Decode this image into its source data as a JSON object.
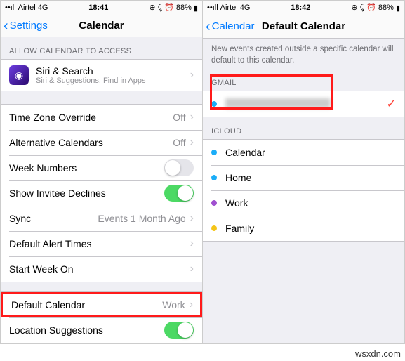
{
  "status": {
    "carrier": "Airtel",
    "network": "4G",
    "time_left": "18:41",
    "time_right": "18:42",
    "battery": "88%"
  },
  "left": {
    "back": "Settings",
    "title": "Calendar",
    "section1": "ALLOW CALENDAR TO ACCESS",
    "siri_title": "Siri & Search",
    "siri_sub": "Siri & Suggestions, Find in Apps",
    "rows": {
      "tzo": {
        "label": "Time Zone Override",
        "value": "Off"
      },
      "alt": {
        "label": "Alternative Calendars",
        "value": "Off"
      },
      "week": {
        "label": "Week Numbers"
      },
      "invitee": {
        "label": "Show Invitee Declines"
      },
      "sync": {
        "label": "Sync",
        "value": "Events 1 Month Ago"
      },
      "alert": {
        "label": "Default Alert Times"
      },
      "weekstart": {
        "label": "Start Week On"
      },
      "defcal": {
        "label": "Default Calendar",
        "value": "Work"
      },
      "loc": {
        "label": "Location Suggestions"
      }
    }
  },
  "right": {
    "back": "Calendar",
    "title": "Default Calendar",
    "desc": "New events created outside a specific calendar will default to this calendar.",
    "gmail_header": "GMAIL",
    "icloud_header": "ICLOUD",
    "icloud": {
      "calendar": "Calendar",
      "home": "Home",
      "work": "Work",
      "family": "Family"
    }
  },
  "watermark": "wsxdn.com"
}
